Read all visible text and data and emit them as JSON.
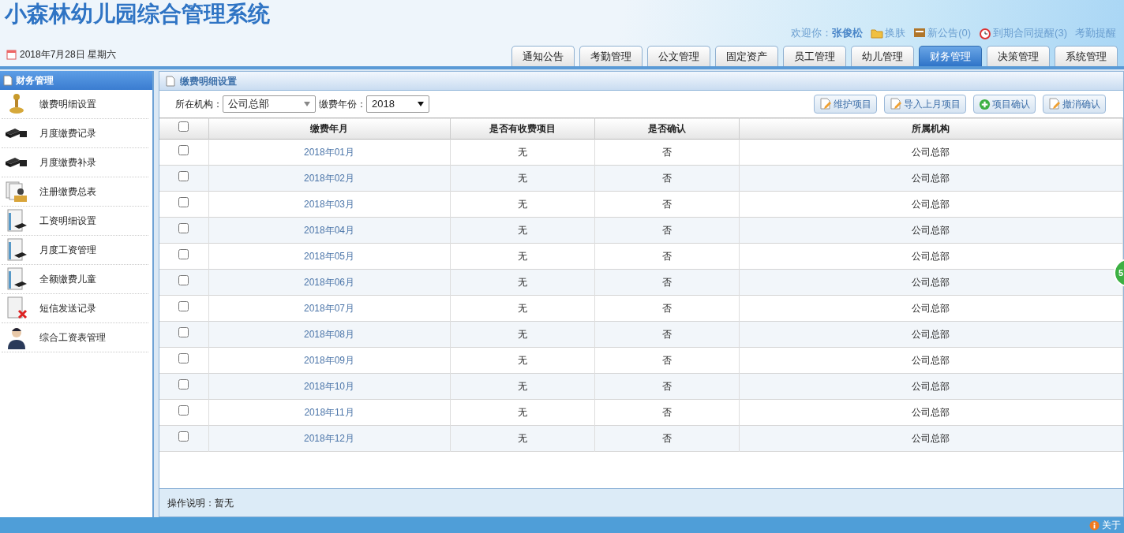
{
  "header": {
    "title": "小森林幼儿园综合管理系统",
    "date": "2018年7月28日 星期六",
    "welcome": "欢迎你：**张俊松**",
    "links": [
      "换肤",
      "新公告(0)",
      "到期合同提醒(3)",
      "考勤提醒"
    ]
  },
  "tabs": [
    {
      "label": "通知公告",
      "selected": false
    },
    {
      "label": "考勤管理",
      "selected": false
    },
    {
      "label": "公文管理",
      "selected": false
    },
    {
      "label": "固定资产",
      "selected": false
    },
    {
      "label": "员工管理",
      "selected": false
    },
    {
      "label": "幼儿管理",
      "selected": false
    },
    {
      "label": "财务管理",
      "selected": true
    },
    {
      "label": "决策管理",
      "selected": false
    },
    {
      "label": "系统管理",
      "selected": false
    }
  ],
  "sidebar": {
    "title": "财务管理",
    "items": [
      "缴费明细设置",
      "月度缴费记录",
      "月度缴费补录",
      "注册缴费总表",
      "工资明细设置",
      "月度工资管理",
      "全额缴费儿童",
      "短信发送记录",
      "综合工资表管理"
    ]
  },
  "panel": {
    "title": "缴费明细设置",
    "filters": [
      {
        "label": "所在机构：",
        "value": "公司总部"
      },
      {
        "label": "缴费年份：",
        "value": "2018"
      }
    ],
    "buttons": [
      {
        "label": "维护项目",
        "kind": "edit"
      },
      {
        "label": "导入上月项目",
        "kind": "edit"
      },
      {
        "label": "项目确认",
        "kind": "add"
      },
      {
        "label": "撤消确认",
        "kind": "edit"
      }
    ],
    "table": {
      "header_checked": false,
      "columns": [
        "缴费年月",
        "是否有收费项目",
        "是否确认",
        "所属机构"
      ],
      "rows": [
        {
          "checked": false,
          "cells": [
            "2018年01月",
            "无",
            "否",
            "公司总部"
          ]
        },
        {
          "checked": false,
          "cells": [
            "2018年02月",
            "无",
            "否",
            "公司总部"
          ]
        },
        {
          "checked": false,
          "cells": [
            "2018年03月",
            "无",
            "否",
            "公司总部"
          ]
        },
        {
          "checked": false,
          "cells": [
            "2018年04月",
            "无",
            "否",
            "公司总部"
          ]
        },
        {
          "checked": false,
          "cells": [
            "2018年05月",
            "无",
            "否",
            "公司总部"
          ]
        },
        {
          "checked": false,
          "cells": [
            "2018年06月",
            "无",
            "否",
            "公司总部"
          ]
        },
        {
          "checked": false,
          "cells": [
            "2018年07月",
            "无",
            "否",
            "公司总部"
          ]
        },
        {
          "checked": false,
          "cells": [
            "2018年08月",
            "无",
            "否",
            "公司总部"
          ]
        },
        {
          "checked": false,
          "cells": [
            "2018年09月",
            "无",
            "否",
            "公司总部"
          ]
        },
        {
          "checked": false,
          "cells": [
            "2018年10月",
            "无",
            "否",
            "公司总部"
          ]
        },
        {
          "checked": false,
          "cells": [
            "2018年11月",
            "无",
            "否",
            "公司总部"
          ]
        },
        {
          "checked": false,
          "cells": [
            "2018年12月",
            "无",
            "否",
            "公司总部"
          ]
        }
      ]
    },
    "note": "操作说明：暂无"
  },
  "floating_badge": "5",
  "status_bar": {
    "about": "关于"
  }
}
